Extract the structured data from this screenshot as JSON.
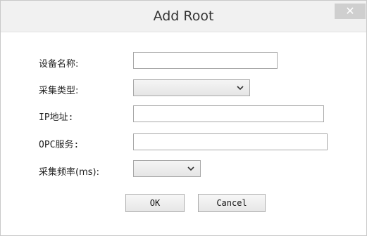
{
  "dialog": {
    "title": "Add Root",
    "close_glyph": "✕"
  },
  "form": {
    "device_name_label": "设备名称:",
    "device_name_value": "",
    "collect_type_label": "采集类型:",
    "collect_type_value": "",
    "ip_label": "IP地址:",
    "ip_value": "",
    "opc_label": "OPC服务:",
    "opc_value": "",
    "freq_label": "采集频率(ms):",
    "freq_value": ""
  },
  "buttons": {
    "ok": "OK",
    "cancel": "Cancel"
  },
  "icons": {
    "dropdown": "chevron-down-icon",
    "close": "close-icon"
  }
}
